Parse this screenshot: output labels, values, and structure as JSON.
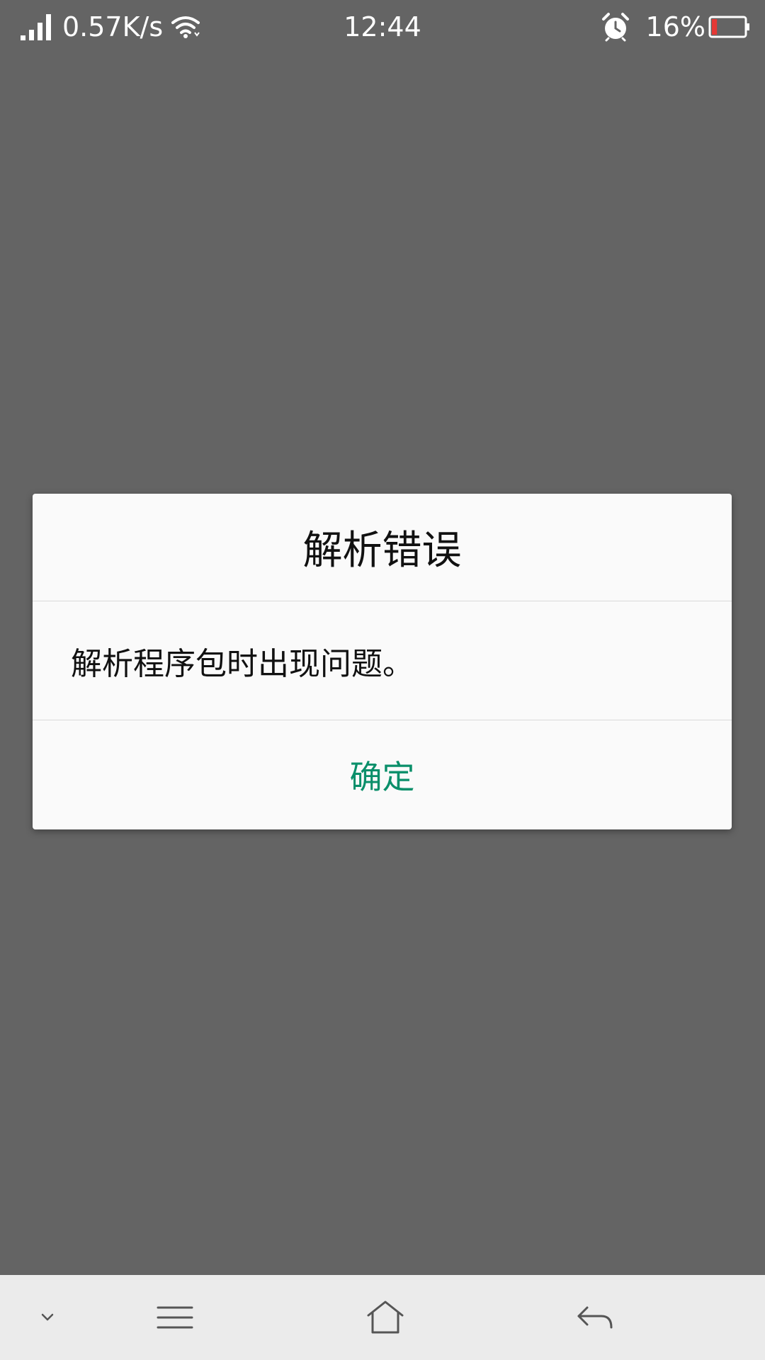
{
  "status_bar": {
    "network_speed": "0.57K/s",
    "time": "12:44",
    "battery_percent": "16%",
    "battery_level": 0.16,
    "battery_low_color": "#e53935"
  },
  "dialog": {
    "title": "解析错误",
    "message": "解析程序包时出现问题。",
    "confirm_label": "确定",
    "confirm_color": "#0a8f6a"
  },
  "nav_bar": {
    "icons": [
      "chevron-down-icon",
      "menu-icon",
      "home-icon",
      "back-icon"
    ]
  },
  "colors": {
    "scrim": "#646464",
    "dialog_bg": "#fafafa",
    "nav_bg": "#ebebeb"
  }
}
